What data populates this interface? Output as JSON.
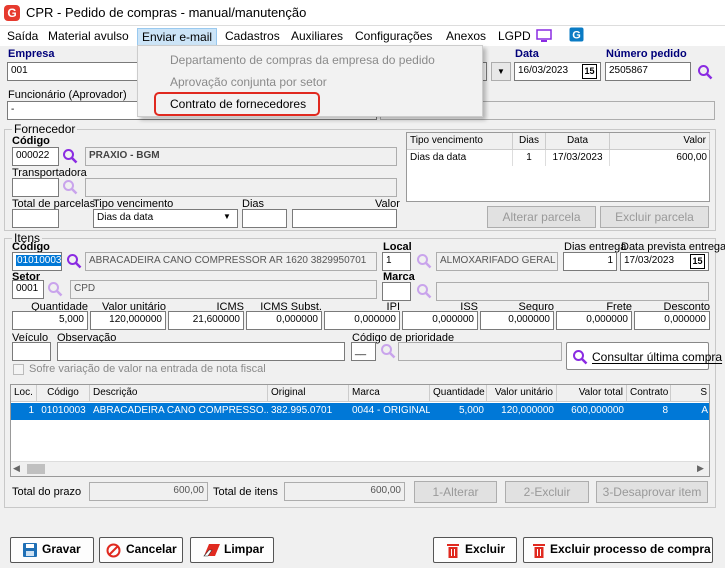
{
  "window": {
    "title": "CPR - Pedido de compras - manual/manutenção",
    "app_icon": "G"
  },
  "menu": {
    "items": [
      "Saída",
      "Material avulso",
      "Enviar e-mail",
      "Cadastros",
      "Auxiliares",
      "Configurações",
      "Anexos",
      "LGPD"
    ],
    "dropdown": [
      "Departamento de compras da empresa do pedido",
      "Aprovação conjunta por setor",
      "Contrato de fornecedores"
    ]
  },
  "header": {
    "empresa_label": "Empresa",
    "empresa_value": "001",
    "data_label": "Data",
    "data_value": "16/03/2023",
    "numero_label": "Número pedido",
    "numero_value": "2505867",
    "funcionario_label": "Funcionário (Aprovador)",
    "funcionario_value": "-"
  },
  "fornecedor": {
    "group_title": "Fornecedor",
    "codigo_label": "Código",
    "codigo_value": "000022",
    "nome": "PRAXIO - BGM",
    "transportadora_label": "Transportadora",
    "parcelas_label": "Total de parcelas",
    "tipo_venc_label": "Tipo vencimento",
    "tipo_venc_value": "Dias da data",
    "dias_label": "Dias",
    "valor_label": "Valor",
    "grid_headers": [
      "Tipo vencimento",
      "Dias",
      "Data",
      "Valor"
    ],
    "grid_rows": [
      [
        "Dias da data",
        "1",
        "17/03/2023",
        "600,00"
      ]
    ],
    "alterar_parcela": "Alterar parcela",
    "excluir_parcela": "Excluir parcela"
  },
  "itens": {
    "group_title": "Itens",
    "codigo_label": "Código",
    "codigo_value": "01010003",
    "descricao": "ABRACADEIRA CANO COMPRESSOR AR 1620 3829950701",
    "local_label": "Local",
    "local_value": "1",
    "local_desc": "ALMOXARIFADO GERAL V",
    "dias_entrega_label": "Dias entrega",
    "dias_entrega_value": "1",
    "data_prevista_label": "Data prevista entrega",
    "data_prevista_value": "17/03/2023",
    "setor_label": "Setor",
    "setor_value": "0001",
    "setor_desc": "CPD",
    "marca_label": "Marca",
    "values": [
      {
        "label": "Quantidade",
        "value": "5,000"
      },
      {
        "label": "Valor unitário",
        "value": "120,000000"
      },
      {
        "label": "ICMS",
        "value": "21,600000"
      },
      {
        "label": "ICMS Subst.",
        "value": "0,000000"
      },
      {
        "label": "IPI",
        "value": "0,000000"
      },
      {
        "label": "ISS",
        "value": "0,000000"
      },
      {
        "label": "Seguro",
        "value": "0,000000"
      },
      {
        "label": "Frete",
        "value": "0,000000"
      },
      {
        "label": "Desconto",
        "value": "0,000000"
      }
    ],
    "veiculo_label": "Veículo",
    "observacao_label": "Observação",
    "prioridade_label": "Código de prioridade",
    "prioridade_value": "__",
    "consultar_btn": "Consultar última compra",
    "checkbox_label": "Sofre variação de valor na entrada de nota fiscal",
    "grid_headers": [
      "Loc.",
      "Código",
      "Descrição",
      "Original",
      "Marca",
      "Quantidade",
      "Valor unitário",
      "Valor total",
      "Contrato",
      "S"
    ],
    "grid_rows": [
      [
        "1",
        "01010003",
        "ABRACADEIRA CANO COMPRESSO...",
        "382.995.0701",
        "0044 - ORIGINAL",
        "5,000",
        "120,000000",
        "600,000000",
        "8",
        "A"
      ]
    ]
  },
  "totals": {
    "prazo_label": "Total do prazo",
    "prazo_value": "600,00",
    "itens_label": "Total de itens",
    "itens_value": "600,00",
    "alterar_btn": "1-Alterar",
    "excluir_btn": "2-Excluir",
    "desaprovar_btn": "3-Desaprovar item"
  },
  "footer": {
    "gravar": "Gravar",
    "cancelar": "Cancelar",
    "limpar": "Limpar",
    "excluir": "Excluir",
    "excluir_processo": "Excluir processo de compra"
  },
  "colors": {
    "accent": "#0078d7",
    "highlight": "#e0291f",
    "magnifier": "#8a2be2",
    "danger": "#e0291f"
  }
}
